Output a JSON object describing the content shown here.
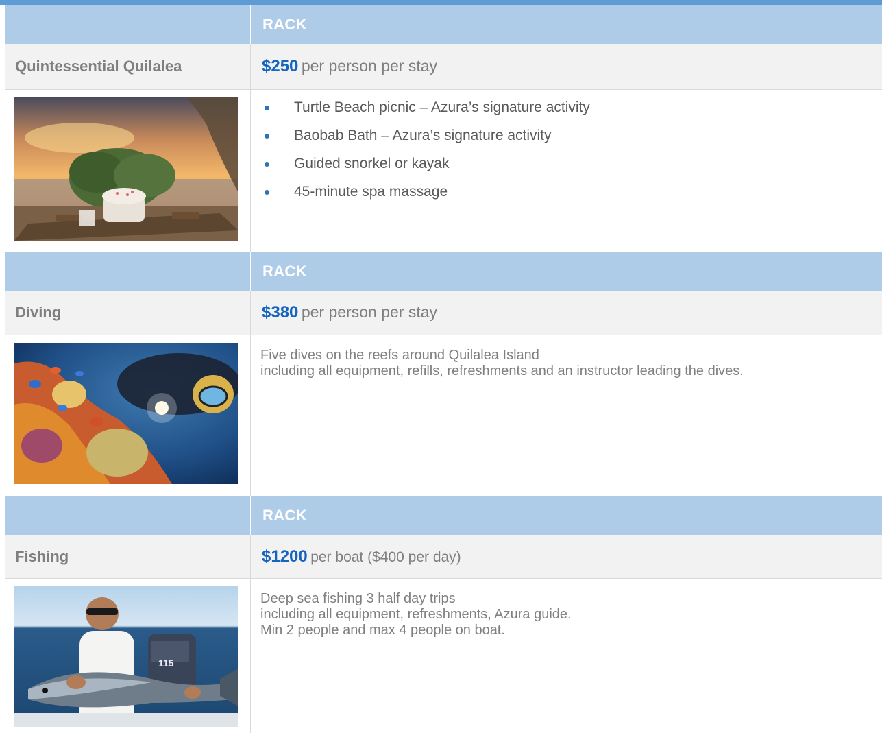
{
  "sections": [
    {
      "header": "RACK",
      "activity": "Quintessential Quilalea",
      "price": "$250",
      "price_suffix": "per person per stay",
      "photo_icon": "sunset-beach-bath-photo",
      "items": [
        "Turtle Beach picnic – Azura’s signature activity",
        "Baobab Bath – Azura’s signature activity",
        "Guided snorkel or kayak",
        "45-minute spa massage"
      ]
    },
    {
      "header": "RACK",
      "activity": "Diving",
      "price": "$380",
      "price_suffix": "per person per stay",
      "photo_icon": "diver-coral-reef-photo",
      "lines": [
        "Five dives on the reefs around Quilalea Island",
        "including all equipment, refills, refreshments and an instructor leading the dives."
      ]
    },
    {
      "header": "RACK",
      "activity": "Fishing",
      "price": "$1200",
      "price_suffix": "per boat ($400 per day)",
      "photo_icon": "angler-holding-fish-photo",
      "engine_label": "115",
      "lines": [
        "Deep sea fishing 3 half day trips",
        "including all equipment, refreshments, Azura guide.",
        "Min 2 people and max 4 people on boat."
      ]
    }
  ],
  "colors": {
    "top_bar": "#5f9bd5",
    "header_bg": "#aecbe8",
    "price": "#1565c0",
    "muted_text": "#7f7f7f"
  }
}
